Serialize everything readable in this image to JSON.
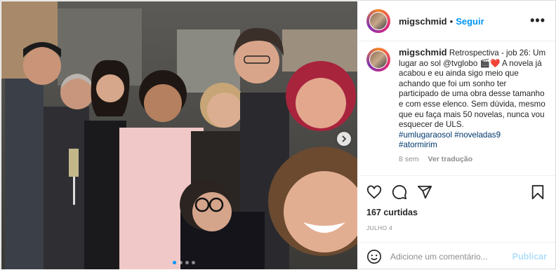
{
  "post": {
    "username": "migschmid",
    "separator": "•",
    "follow_label": "Seguir",
    "more_label": "•••",
    "caption": {
      "username": "migschmid",
      "text": "Retrospectiva - job 26: Um lugar ao sol @tvglobo 🎬❤️ A novela já acabou e eu ainda sigo meio que achando que foi um sonho ter participado de uma obra desse tamanho e com esse elenco. Sem dúvida, mesmo que eu faça mais 50 novelas, nunca vou esquecer de ULS.",
      "hashtags": [
        "#umlugaraosol",
        "#noveladas9",
        "#atormirim"
      ],
      "age": "8 sem",
      "translate_label": "Ver tradução"
    },
    "likes": "167 curtidas",
    "date": "JULHO 4",
    "comment_placeholder": "Adicione um comentário...",
    "publish_label": "Publicar",
    "carousel": {
      "slides": 4,
      "active_index": 0
    }
  },
  "icons": [
    "heart-icon",
    "comment-icon",
    "share-icon",
    "bookmark-icon",
    "emoji-icon",
    "chevron-right-icon",
    "more-icon"
  ],
  "colors": {
    "link_blue": "#0095f6",
    "hashtag": "#00376b",
    "muted": "#8e8e8e",
    "publish_disabled": "#b2dffc"
  }
}
